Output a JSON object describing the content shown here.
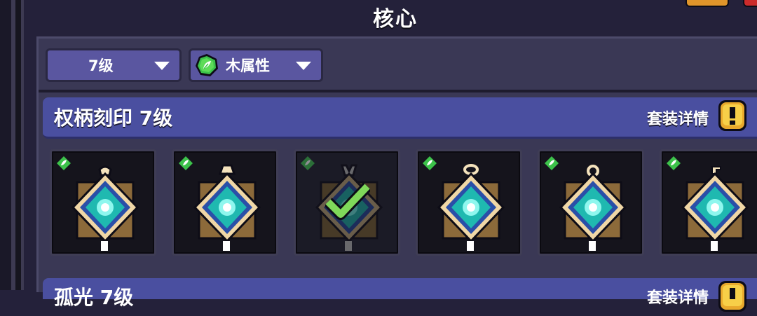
{
  "header": {
    "title": "核心"
  },
  "filters": {
    "level": {
      "label": "7级"
    },
    "attribute": {
      "label": "木属性",
      "icon": "wood-element-icon"
    }
  },
  "set": {
    "title": "权柄刻印 7级",
    "detail_label": "套装详情"
  },
  "next_set": {
    "title": "孤光 7级",
    "detail_label": "套装详情"
  },
  "cards": [
    {
      "name": "scepter-seal-1",
      "top_ornament": "ring",
      "selected": false
    },
    {
      "name": "scepter-seal-2",
      "top_ornament": "cap",
      "selected": false
    },
    {
      "name": "scepter-seal-3",
      "top_ornament": "fork",
      "selected": true
    },
    {
      "name": "scepter-seal-4",
      "top_ornament": "loop",
      "selected": false
    },
    {
      "name": "scepter-seal-5",
      "top_ornament": "ring-small",
      "selected": false
    },
    {
      "name": "scepter-seal-6",
      "top_ornament": "hook",
      "selected": false
    }
  ],
  "colors": {
    "background": "#24213a",
    "panel": "#3a3855",
    "filter_bg": "#5a56a0",
    "set_bar": "#4a4fa0",
    "wood_green": "#3cc24a",
    "gem_cyan": "#2fe0c8",
    "frame_gold": "#d8b878"
  }
}
